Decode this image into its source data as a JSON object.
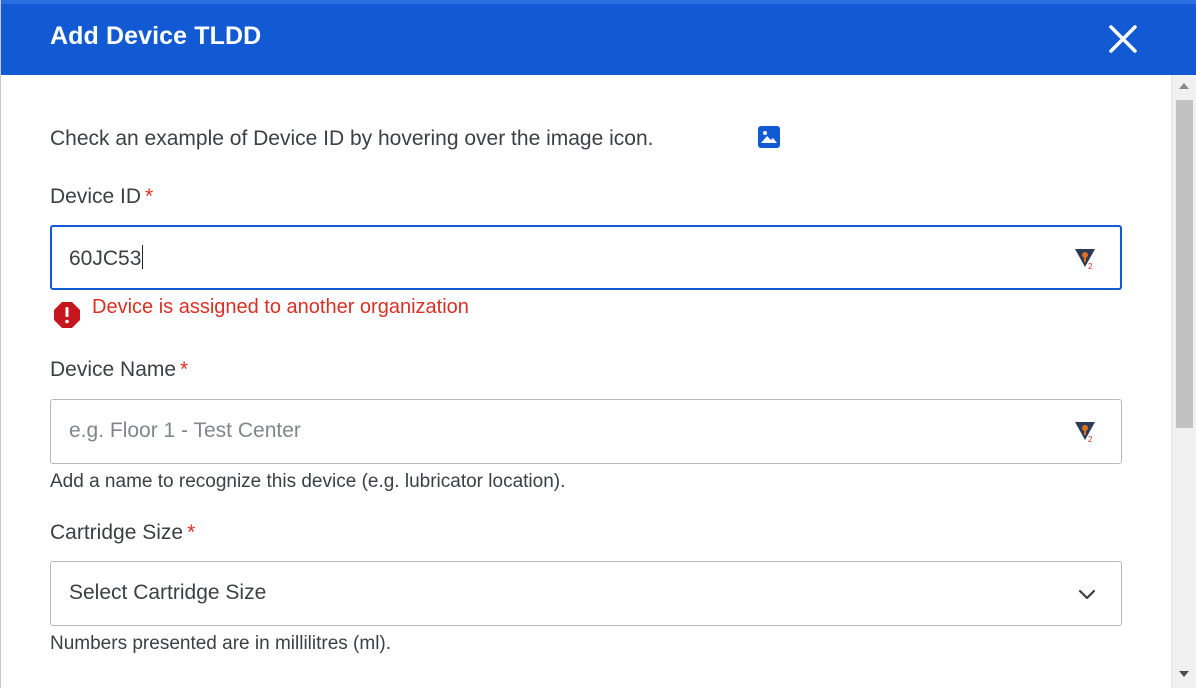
{
  "dialog": {
    "title": "Add Device TLDD",
    "close_icon": "close-icon"
  },
  "hint": {
    "text": "Check an example of Device ID by hovering over the image icon.",
    "icon": "image-icon"
  },
  "device_id": {
    "label": "Device ID",
    "required": "*",
    "value": "60JC53",
    "error": "Device is assigned to another organization",
    "error_icon": "error-icon"
  },
  "device_name": {
    "label": "Device Name",
    "required": "*",
    "placeholder": "e.g. Floor 1 - Test Center",
    "help": "Add a name to recognize this device (e.g. lubricator location)."
  },
  "cartridge_size": {
    "label": "Cartridge Size",
    "required": "*",
    "selected": "Select Cartridge Size",
    "help": "Numbers presented are in millilitres (ml)."
  },
  "colors": {
    "header": "#115ad4",
    "error": "#d93025",
    "focus": "#115ad4"
  }
}
